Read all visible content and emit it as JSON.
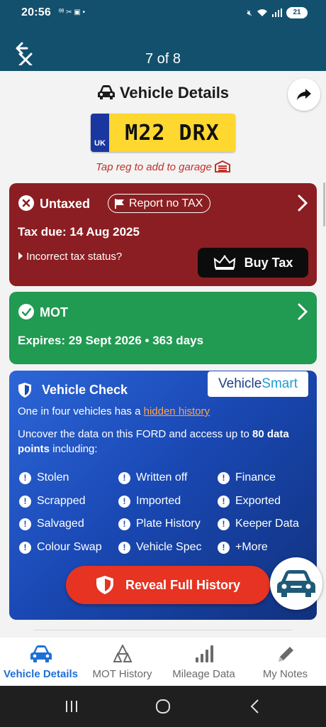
{
  "status_bar": {
    "time": "20:56",
    "left_icons": "ᶿᶿ ✂ ▣ •",
    "battery": "21"
  },
  "app_bar": {
    "counter": "7 of 8"
  },
  "header": {
    "title": "Vehicle Details"
  },
  "plate": {
    "country": "UK",
    "registration": "M22 DRX"
  },
  "garage_link": "Tap reg to add to garage",
  "tax_card": {
    "status": "Untaxed",
    "report_label": "Report no TAX",
    "due": "Tax due: 14 Aug 2025",
    "incorrect": "Incorrect tax status?",
    "buy_label": "Buy Tax",
    "color": "#8b1e22"
  },
  "mot_card": {
    "status": "MOT",
    "expires": "Expires: 29 Sept 2026 • 363 days",
    "color": "#219a52"
  },
  "vehicle_check": {
    "heading": "Vehicle Check",
    "logo_main": "Vehicle",
    "logo_accent": "Smart",
    "line1_prefix": "One in four vehicles has a ",
    "line1_link": "hidden history",
    "line2_prefix": "Uncover the data on this FORD and access up to ",
    "line2_bold": "80 data points",
    "line2_suffix": " including:",
    "features": [
      "Stolen",
      "Written off",
      "Finance",
      "Scrapped",
      "Imported",
      "Exported",
      "Salvaged",
      "Plate History",
      "Keeper Data",
      "Colour Swap",
      "Vehicle Spec",
      "+More"
    ],
    "cta": "Reveal Full History"
  },
  "bottom_nav": {
    "items": [
      {
        "label": "Vehicle Details",
        "icon": "car-icon"
      },
      {
        "label": "MOT History",
        "icon": "cones-icon"
      },
      {
        "label": "Mileage Data",
        "icon": "bar-chart-icon"
      },
      {
        "label": "My Notes",
        "icon": "pencil-icon"
      }
    ],
    "active_color": "#1f6fd6"
  }
}
